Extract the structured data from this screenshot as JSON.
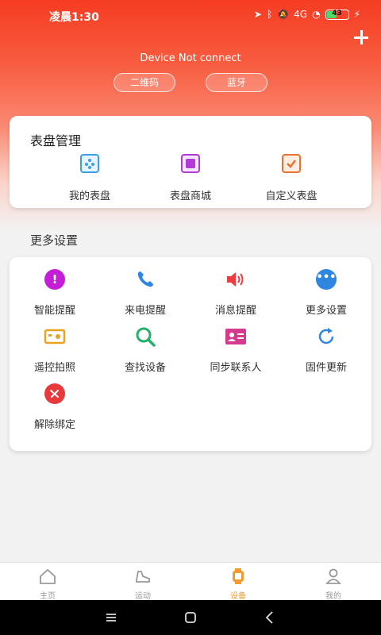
{
  "status_bar": {
    "time": "凌晨1:30",
    "signal_text": "4G",
    "battery_level": "43",
    "battery_fraction": 0.43
  },
  "header": {
    "add_icon": "plus-icon",
    "device_status": "Device Not connect",
    "qr_button": "二维码",
    "bluetooth_button": "蓝牙"
  },
  "dial_management": {
    "title": "表盘管理",
    "items": [
      {
        "label": "我的表盘",
        "icon": "watch-face-icon",
        "color": "#3aa0e8"
      },
      {
        "label": "表盘商城",
        "icon": "store-icon",
        "color": "#b13ad8"
      },
      {
        "label": "自定义表盘",
        "icon": "custom-dial-icon",
        "color": "#e8732e"
      }
    ]
  },
  "more_settings": {
    "section_title": "更多设置",
    "items": [
      {
        "label": "智能提醒",
        "icon": "alert-icon",
        "color": "#c41ed6"
      },
      {
        "label": "来电提醒",
        "icon": "phone-icon",
        "color": "#2f86e0"
      },
      {
        "label": "消息提醒",
        "icon": "speaker-icon",
        "color": "#ee3b3b"
      },
      {
        "label": "更多设置",
        "icon": "more-icon",
        "color": "#2f86e0"
      },
      {
        "label": "遥控拍照",
        "icon": "camera-icon",
        "color": "#e8a21e"
      },
      {
        "label": "查找设备",
        "icon": "search-icon",
        "color": "#22b06b"
      },
      {
        "label": "同步联系人",
        "icon": "contact-card-icon",
        "color": "#d43b8e"
      },
      {
        "label": "固件更新",
        "icon": "refresh-icon",
        "color": "#2f86e0"
      },
      {
        "label": "解除绑定",
        "icon": "unlink-icon",
        "color": "#e8393b"
      }
    ]
  },
  "tab_bar": {
    "tabs": [
      {
        "label": "主页",
        "icon": "home-icon",
        "active": false
      },
      {
        "label": "运动",
        "icon": "shoe-icon",
        "active": false
      },
      {
        "label": "设备",
        "icon": "watch-icon",
        "active": true
      },
      {
        "label": "我的",
        "icon": "user-icon",
        "active": false
      }
    ],
    "accent_color": "#f29a2e"
  }
}
